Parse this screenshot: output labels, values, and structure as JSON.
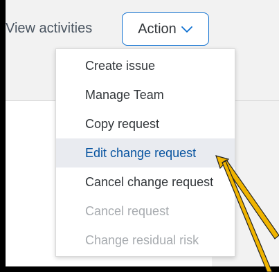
{
  "toolbar": {
    "view_activities": "View activities",
    "action_label": "Action"
  },
  "menu": {
    "items": [
      {
        "label": "Create issue",
        "state": "enabled"
      },
      {
        "label": "Manage Team",
        "state": "enabled"
      },
      {
        "label": "Copy request",
        "state": "enabled"
      },
      {
        "label": "Edit change request",
        "state": "hovered"
      },
      {
        "label": "Cancel change request",
        "state": "enabled"
      },
      {
        "label": "Cancel request",
        "state": "disabled"
      },
      {
        "label": "Change residual risk",
        "state": "disabled"
      }
    ]
  },
  "colors": {
    "accent": "#0a6ed1",
    "active_text": "#0854a0",
    "disabled_text": "#a7abaf",
    "annotation_arrow": "#f0b400"
  },
  "icons": {
    "action_dropdown": "chevron-down-icon"
  }
}
